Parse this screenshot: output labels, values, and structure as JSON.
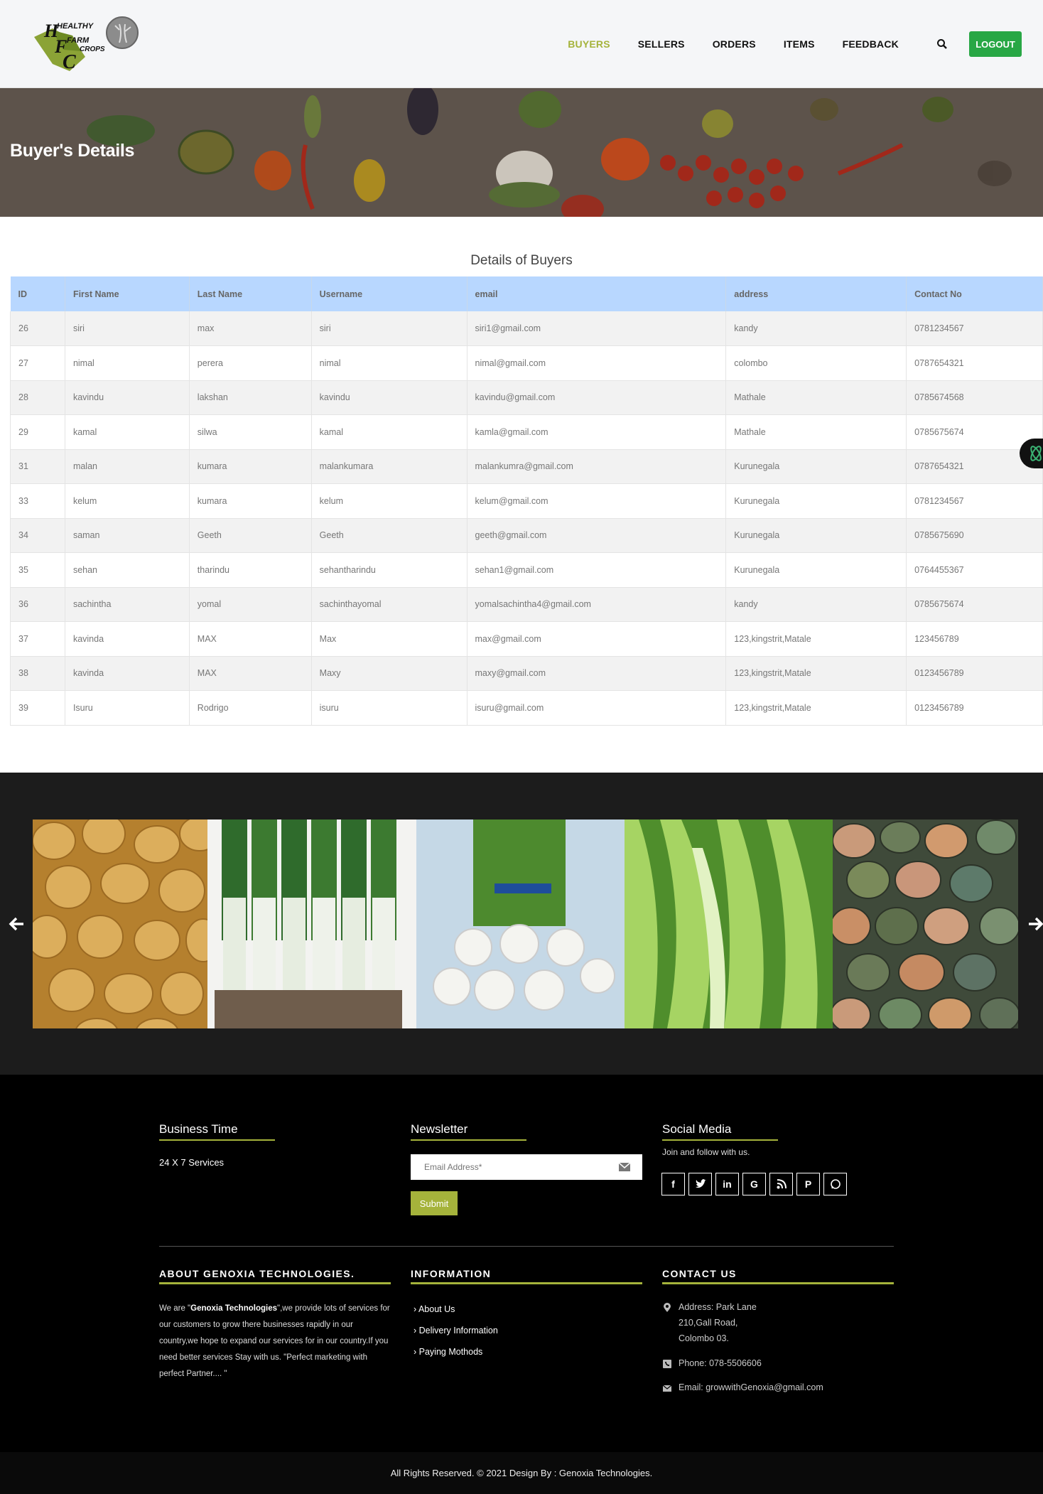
{
  "header": {
    "logo_text": [
      "HEALTHY",
      "FARM",
      "CROPS"
    ],
    "nav": [
      {
        "label": "BUYERS",
        "active": true
      },
      {
        "label": "SELLERS",
        "active": false
      },
      {
        "label": "ORDERS",
        "active": false
      },
      {
        "label": "ITEMS",
        "active": false
      },
      {
        "label": "FEEDBACK",
        "active": false
      }
    ],
    "logout_label": "LOGOUT",
    "accent_color": "#a5b33b",
    "logout_color": "#28a745"
  },
  "banner": {
    "title": "Buyer's Details"
  },
  "table": {
    "caption": "Details of Buyers",
    "header_color": "#b8d7ff",
    "columns": [
      "ID",
      "First Name",
      "Last Name",
      "Username",
      "email",
      "address",
      "Contact No"
    ],
    "rows": [
      [
        "26",
        "siri",
        "max",
        "siri",
        "siri1@gmail.com",
        "kandy",
        "0781234567"
      ],
      [
        "27",
        "nimal",
        "perera",
        "nimal",
        "nimal@gmail.com",
        "colombo",
        "0787654321"
      ],
      [
        "28",
        "kavindu",
        "lakshan",
        "kavindu",
        "kavindu@gmail.com",
        "Mathale",
        "0785674568"
      ],
      [
        "29",
        "kamal",
        "silwa",
        "kamal",
        "kamla@gmail.com",
        "Mathale",
        "0785675674"
      ],
      [
        "31",
        "malan",
        "kumara",
        "malankumara",
        "malankumra@gmail.com",
        "Kurunegala",
        "0787654321"
      ],
      [
        "33",
        "kelum",
        "kumara",
        "kelum",
        "kelum@gmail.com",
        "Kurunegala",
        "0781234567"
      ],
      [
        "34",
        "saman",
        "Geeth",
        "Geeth",
        "geeth@gmail.com",
        "Kurunegala",
        "0785675690"
      ],
      [
        "35",
        "sehan",
        "tharindu",
        "sehantharindu",
        "sehan1@gmail.com",
        "Kurunegala",
        "0764455367"
      ],
      [
        "36",
        "sachintha",
        "yomal",
        "sachinthayomal",
        "yomalsachintha4@gmail.com",
        "kandy",
        "0785675674"
      ],
      [
        "37",
        "kavinda",
        "MAX",
        "Max",
        "max@gmail.com",
        "123,kingstrit,Matale",
        "123456789"
      ],
      [
        "38",
        "kavinda",
        "MAX",
        "Maxy",
        "maxy@gmail.com",
        "123,kingstrit,Matale",
        "0123456789"
      ],
      [
        "39",
        "Isuru",
        "Rodrigo",
        "isuru",
        "isuru@gmail.com",
        "123,kingstrit,Matale",
        "0123456789"
      ]
    ]
  },
  "carousel": {
    "slides": [
      "potatoes",
      "leeks",
      "turnips",
      "lettuce",
      "pumpkins"
    ]
  },
  "footer": {
    "business_time": {
      "heading": "Business Time",
      "text": "24 X 7 Services"
    },
    "newsletter": {
      "heading": "Newsletter",
      "placeholder": "Email Address*",
      "submit": "Submit"
    },
    "social": {
      "heading": "Social Media",
      "text": "Join and follow with us.",
      "icons": [
        "facebook-icon",
        "twitter-icon",
        "linkedin-icon",
        "google-plus-icon",
        "rss-icon",
        "pinterest-icon",
        "whatsapp-icon"
      ]
    },
    "about": {
      "heading": "ABOUT GENOXIA TECHNOLOGIES.",
      "pre": "We are \"",
      "bold": "Genoxia Technologies",
      "post": "\",we provide lots of services for our customers to grow there businesses rapidly in our country,we hope to expand our services for in our country.If you need better services Stay with us. \"Perfect marketing with perfect Partner.... \""
    },
    "information": {
      "heading": "INFORMATION",
      "links": [
        "About Us",
        "Delivery Information",
        "Paying Mothods"
      ]
    },
    "contact": {
      "heading": "CONTACT US",
      "address": [
        "Address: Park Lane",
        "210,Gall Road,",
        "Colombo 03."
      ],
      "phone": "Phone: 078-5506606",
      "email": "Email: growwithGenoxia@gmail.com"
    },
    "copyright": "All Rights Reserved. © 2021 Design By : Genoxia Technologies."
  }
}
